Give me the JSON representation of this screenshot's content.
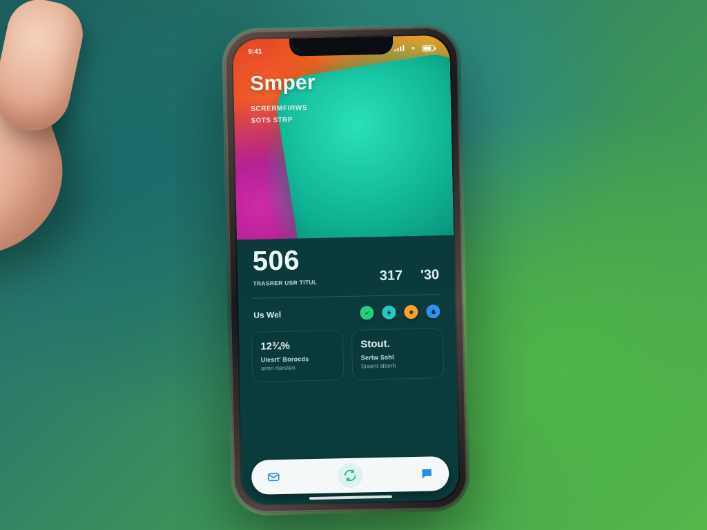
{
  "colors": {
    "accent_teal": "#17b896",
    "accent_orange": "#f08a1e",
    "accent_magenta": "#cf2aa9",
    "nav_icon": "#2a8de6"
  },
  "statusbar": {
    "time": "9:41"
  },
  "hero": {
    "title": "Smper",
    "sub1": "Scrermfirws",
    "sub2": "SOTS STRP"
  },
  "stats": {
    "primary": {
      "value": "506",
      "label": "Trasrer usr Titul"
    },
    "secondary1": {
      "value": "317"
    },
    "secondary2": {
      "value": "'30"
    }
  },
  "row": {
    "label": "Us Wel",
    "chips": [
      {
        "name": "check-icon",
        "color": "green"
      },
      {
        "name": "bolt-icon",
        "color": "cyan"
      },
      {
        "name": "coin-icon",
        "color": "orange"
      },
      {
        "name": "drop-icon",
        "color": "blue"
      }
    ]
  },
  "cards": [
    {
      "value": "12¾%",
      "line1": "Ulesrt' Borocds",
      "line2": "uenn rtersten"
    },
    {
      "value": "Stout.",
      "line1": "Sertw Sshl",
      "line2": "Sraent idtierh"
    }
  ],
  "nav": {
    "left": {
      "name": "mail-icon"
    },
    "center": {
      "name": "refresh-icon"
    },
    "right": {
      "name": "chat-icon"
    }
  }
}
